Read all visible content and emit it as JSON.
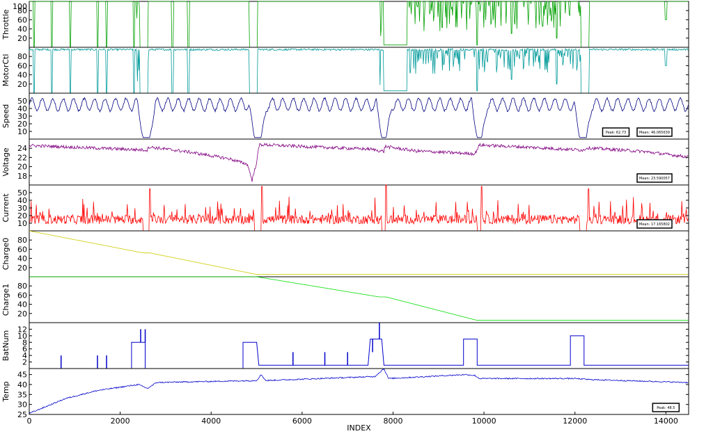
{
  "chart_data": {
    "type": "line",
    "xlabel": "INDEX",
    "xlim": [
      0,
      14500
    ],
    "x_ticks": [
      0,
      2000,
      4000,
      6000,
      8000,
      10000,
      12000,
      14000
    ],
    "panels": [
      {
        "id": "throttle",
        "ylabel": "Throttle",
        "color": "#00a000",
        "ylim": [
          0,
          100
        ],
        "yticks": [
          20,
          40,
          60,
          80
        ],
        "tick_labels": [
          "20",
          "40",
          "60",
          "80"
        ],
        "top_label": "100",
        "mode": "pulse",
        "base": 100,
        "noise": 0,
        "dips": [
          [
            100,
            100,
            0
          ],
          [
            500,
            500,
            0
          ],
          [
            900,
            900,
            0
          ],
          [
            1500,
            1500,
            0
          ],
          [
            1700,
            1700,
            0
          ],
          [
            2300,
            2300,
            0
          ],
          [
            2450,
            2600,
            0
          ],
          [
            3150,
            3150,
            0
          ],
          [
            3500,
            3500,
            0
          ],
          [
            4850,
            5000,
            0
          ],
          [
            7800,
            8300,
            5
          ],
          [
            9850,
            9850,
            5
          ],
          [
            10600,
            10600,
            30
          ],
          [
            11600,
            11600,
            20
          ],
          [
            12150,
            12300,
            0
          ],
          [
            14000,
            14000,
            60
          ]
        ],
        "bursts": [
          [
            2350,
            2650,
            0
          ],
          [
            7700,
            8000,
            10
          ],
          [
            8000,
            10000,
            35
          ],
          [
            10000,
            12200,
            40
          ]
        ],
        "stats": []
      },
      {
        "id": "motorctl",
        "ylabel": "MotorCtl",
        "color": "#009999",
        "ylim": [
          0,
          100
        ],
        "yticks": [
          20,
          40,
          60,
          80
        ],
        "tick_labels": [
          "20",
          "40",
          "60",
          "80"
        ],
        "top_label": "",
        "mode": "pulse",
        "base": 95,
        "noise": 4,
        "dips": [
          [
            100,
            100,
            0
          ],
          [
            500,
            500,
            0
          ],
          [
            900,
            900,
            0
          ],
          [
            1500,
            1500,
            0
          ],
          [
            1700,
            1700,
            0
          ],
          [
            2300,
            2300,
            0
          ],
          [
            2450,
            2600,
            0
          ],
          [
            3150,
            3150,
            0
          ],
          [
            3500,
            3500,
            0
          ],
          [
            4850,
            5000,
            0
          ],
          [
            7800,
            8300,
            5
          ],
          [
            9850,
            9850,
            5
          ],
          [
            10600,
            10600,
            30
          ],
          [
            11600,
            11600,
            20
          ],
          [
            12150,
            12300,
            0
          ],
          [
            14000,
            14000,
            60
          ]
        ],
        "bursts": [
          [
            2350,
            2650,
            0
          ],
          [
            7700,
            8000,
            10
          ],
          [
            8000,
            10000,
            40
          ],
          [
            10000,
            12200,
            45
          ]
        ],
        "stats": []
      },
      {
        "id": "speed",
        "ylabel": "Speed",
        "color": "#000080",
        "ylim": [
          0,
          60
        ],
        "yticks": [
          10,
          20,
          30,
          40,
          50
        ],
        "tick_labels": [
          "10",
          "20",
          "30",
          "40",
          "50"
        ],
        "top_label": "",
        "mode": "wave",
        "base": 45,
        "amp": 8,
        "period": 230,
        "dips": [
          [
            2500,
            2650,
            2
          ],
          [
            4950,
            5100,
            2
          ],
          [
            7750,
            7850,
            2
          ],
          [
            9850,
            9950,
            2
          ],
          [
            12100,
            12250,
            2
          ]
        ],
        "stats": [
          {
            "text": "Peak: 62.73",
            "x": 12900
          },
          {
            "text": "Mean: 46.065639",
            "x": 13750
          }
        ]
      },
      {
        "id": "voltage",
        "ylabel": "Voltage",
        "color": "#800080",
        "ylim": [
          16,
          26
        ],
        "yticks": [
          18,
          20,
          22,
          24
        ],
        "tick_labels": [
          "18",
          "20",
          "22",
          "24"
        ],
        "top_label": "",
        "mode": "points",
        "noise": 0.35,
        "points": [
          [
            0,
            24.6
          ],
          [
            2600,
            23.6
          ],
          [
            2620,
            24.3
          ],
          [
            3500,
            23.2
          ],
          [
            4400,
            21.7
          ],
          [
            4800,
            20.5
          ],
          [
            4900,
            17.0
          ],
          [
            5000,
            21.0
          ],
          [
            5060,
            24.8
          ],
          [
            6200,
            24.3
          ],
          [
            7500,
            23.8
          ],
          [
            7800,
            23.3
          ],
          [
            7820,
            24.4
          ],
          [
            8500,
            23.4
          ],
          [
            9800,
            22.8
          ],
          [
            9900,
            24.7
          ],
          [
            10800,
            24.3
          ],
          [
            12200,
            23.6
          ],
          [
            12250,
            24.1
          ],
          [
            13500,
            23.3
          ],
          [
            14500,
            22.1
          ]
        ],
        "stats": [
          {
            "text": "Mean: 23.590057",
            "x": 13750
          }
        ]
      },
      {
        "id": "current",
        "ylabel": "Current",
        "color": "#ff0000",
        "ylim": [
          0,
          60
        ],
        "yticks": [
          10,
          20,
          30,
          40,
          50
        ],
        "tick_labels": [
          "10",
          "20",
          "30",
          "40",
          "50"
        ],
        "top_label": "",
        "mode": "spiky",
        "base": 15,
        "noise": 6,
        "spikes": [
          [
            2650,
            55
          ],
          [
            5120,
            58
          ],
          [
            7850,
            60
          ],
          [
            9950,
            58
          ],
          [
            12300,
            55
          ]
        ],
        "dips": [
          [
            2500,
            2650,
            0
          ],
          [
            4950,
            5100,
            0
          ],
          [
            7750,
            7850,
            0
          ],
          [
            9850,
            9950,
            0
          ],
          [
            12100,
            12250,
            0
          ]
        ],
        "stats": [
          {
            "text": "Mean: 17.165802",
            "x": 13750
          }
        ]
      },
      {
        "id": "charge0",
        "ylabel": "Charge0",
        "color": "#cccc00",
        "ylim": [
          0,
          100
        ],
        "yticks": [
          20,
          40,
          60,
          80
        ],
        "tick_labels": [
          "20",
          "40",
          "60",
          "80"
        ],
        "top_label": "",
        "mode": "points",
        "noise": 0,
        "points": [
          [
            0,
            100
          ],
          [
            2500,
            52
          ],
          [
            2650,
            52
          ],
          [
            5000,
            5
          ],
          [
            14500,
            5
          ]
        ],
        "stats": []
      },
      {
        "id": "charge1",
        "ylabel": "Charge1",
        "color": "#00dd00",
        "ylim": [
          0,
          100
        ],
        "yticks": [
          20,
          40,
          60,
          80
        ],
        "tick_labels": [
          "20",
          "40",
          "60",
          "80"
        ],
        "top_label": "",
        "mode": "points",
        "noise": 0,
        "points": [
          [
            0,
            100
          ],
          [
            5000,
            100
          ],
          [
            7700,
            56
          ],
          [
            7850,
            56
          ],
          [
            9850,
            5
          ],
          [
            14500,
            5
          ]
        ],
        "stats": []
      },
      {
        "id": "batnum",
        "ylabel": "BatNum",
        "color": "#0000cc",
        "ylim": [
          0,
          14
        ],
        "yticks": [
          2,
          4,
          6,
          8,
          10,
          12
        ],
        "tick_labels": [
          "2",
          "4",
          "6",
          "8",
          "10",
          "12"
        ],
        "top_label": "",
        "mode": "points",
        "noise": 0,
        "points": [
          [
            0,
            0
          ],
          [
            2250,
            0
          ],
          [
            2250,
            8
          ],
          [
            2550,
            8
          ],
          [
            2550,
            0
          ],
          [
            2600,
            0
          ],
          [
            4700,
            0
          ],
          [
            4700,
            8
          ],
          [
            5000,
            8
          ],
          [
            5050,
            1
          ],
          [
            7450,
            1
          ],
          [
            7500,
            9
          ],
          [
            7750,
            9
          ],
          [
            7800,
            1
          ],
          [
            9550,
            1
          ],
          [
            9550,
            9
          ],
          [
            9850,
            9
          ],
          [
            9850,
            1
          ],
          [
            11900,
            1
          ],
          [
            11900,
            10
          ],
          [
            12200,
            10
          ],
          [
            12200,
            1
          ],
          [
            14500,
            1
          ]
        ],
        "spikes": [
          [
            700,
            4
          ],
          [
            1500,
            4
          ],
          [
            1700,
            4
          ],
          [
            2450,
            12
          ],
          [
            2550,
            12
          ],
          [
            5800,
            5
          ],
          [
            6500,
            5
          ],
          [
            7000,
            5
          ],
          [
            7550,
            5
          ],
          [
            7700,
            14
          ]
        ],
        "stats": []
      },
      {
        "id": "temp",
        "ylabel": "Temp",
        "color": "#0000cc",
        "ylim": [
          25,
          48
        ],
        "yticks": [
          25,
          30,
          35,
          40,
          45
        ],
        "tick_labels": [
          "25",
          "30",
          "35",
          "40",
          "45"
        ],
        "top_label": "",
        "mode": "points",
        "noise": 0.3,
        "points": [
          [
            0,
            25.5
          ],
          [
            800,
            33
          ],
          [
            1500,
            37
          ],
          [
            2400,
            40
          ],
          [
            2600,
            38
          ],
          [
            2800,
            41
          ],
          [
            5000,
            42
          ],
          [
            5100,
            45
          ],
          [
            5200,
            42
          ],
          [
            7600,
            44
          ],
          [
            7800,
            48
          ],
          [
            7900,
            43
          ],
          [
            9600,
            45
          ],
          [
            9800,
            44.5
          ],
          [
            9900,
            43
          ],
          [
            12000,
            43
          ],
          [
            12300,
            42.5
          ],
          [
            14500,
            41
          ]
        ],
        "stats": [
          {
            "text": "Peak: 48.5",
            "x": 14000
          }
        ]
      }
    ]
  }
}
